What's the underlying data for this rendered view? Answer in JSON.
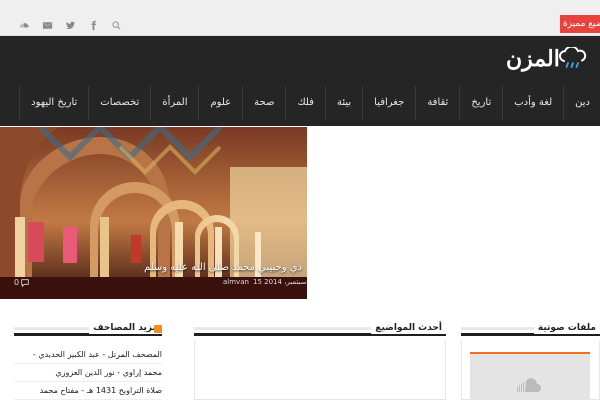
{
  "topbar": {
    "featured_label": "مواضيع مميزة",
    "social_icons": [
      "search-icon",
      "facebook-icon",
      "twitter-icon",
      "email-icon",
      "soundcloud-icon"
    ]
  },
  "header": {
    "logo_text": "المزن",
    "logo_icon": "cloud-rain-icon",
    "background": "#252525"
  },
  "nav": {
    "items": [
      "دين",
      "لغة وأدب",
      "تاريخ",
      "ثقافة",
      "جغرافيا",
      "بيئة",
      "فلك",
      "صحة",
      "علوم",
      "المرأة",
      "تخصصات",
      "تاريخ اليهود"
    ]
  },
  "slider": {
    "title": "دي وحبيبي محمد صلى الله عليه وسلم",
    "date": "15 سبتمبر، 2014",
    "author": "almvan",
    "comments": "0"
  },
  "widgets": {
    "mushaf": {
      "title": "مزيد المصاحف",
      "items": [
        "المصحف المرتل - عبد الكبير الحديدي -",
        "محمد إراوي - نور الدين العزوزي",
        "صلاة التراويح 1431 هـ - مفتاح محمد"
      ]
    },
    "latest": {
      "title": "أحدث المواضيع"
    },
    "audio": {
      "title": "ملفات صوتية"
    }
  },
  "colors": {
    "accent": "#e8423c",
    "soundcloud_orange": "#f26f21"
  }
}
